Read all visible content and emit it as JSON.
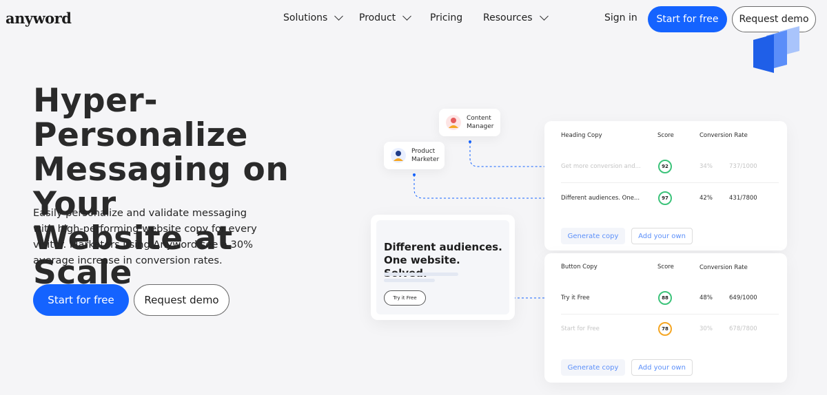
{
  "brand": {
    "logo_text": "anyword",
    "accent": "#1463ff"
  },
  "nav": {
    "items": [
      {
        "label": "Solutions",
        "has_dropdown": true
      },
      {
        "label": "Product",
        "has_dropdown": true
      },
      {
        "label": "Pricing",
        "has_dropdown": false
      },
      {
        "label": "Resources",
        "has_dropdown": true
      }
    ],
    "sign_in": "Sign in",
    "start_free": "Start for free",
    "request_demo": "Request demo"
  },
  "hero": {
    "title_lines": [
      "Hyper-Personalize",
      "Messaging on Your",
      "Website at Scale"
    ],
    "subtitle": "Easily personalize and validate messaging with high-performing website copy for every visitor. Marketers using Anyword see a 30% average increase in conversion rates.",
    "cta_primary": "Start for free",
    "cta_secondary": "Request demo"
  },
  "illustration": {
    "personas": [
      {
        "line1": "Content",
        "line2": "Manager"
      },
      {
        "line1": "Product",
        "line2": "Marketer"
      }
    ],
    "heading_table": {
      "col_copy": "Heading Copy",
      "col_score": "Score",
      "col_rate": "Conversion Rate",
      "rows": [
        {
          "copy": "Get more conversion and...",
          "score": "92",
          "rate": "34%",
          "ratio": "737/1000",
          "faded": true
        },
        {
          "copy": "Different audiences. One...",
          "score": "97",
          "rate": "42%",
          "ratio": "431/7800",
          "faded": false
        }
      ],
      "generate": "Generate copy",
      "add_own": "Add your own"
    },
    "button_table": {
      "col_copy": "Button Copy",
      "col_score": "Score",
      "col_rate": "Conversion Rate",
      "rows": [
        {
          "copy": "Try it Free",
          "score": "88",
          "rate": "48%",
          "ratio": "649/1000",
          "faded": false
        },
        {
          "copy": "Start for Free",
          "score": "78",
          "rate": "30%",
          "ratio": "678/7800",
          "faded": true
        }
      ],
      "generate": "Generate copy",
      "add_own": "Add your own"
    },
    "preview": {
      "title": "Different audiences. One website. Solved.",
      "button": "Try it Free"
    }
  }
}
